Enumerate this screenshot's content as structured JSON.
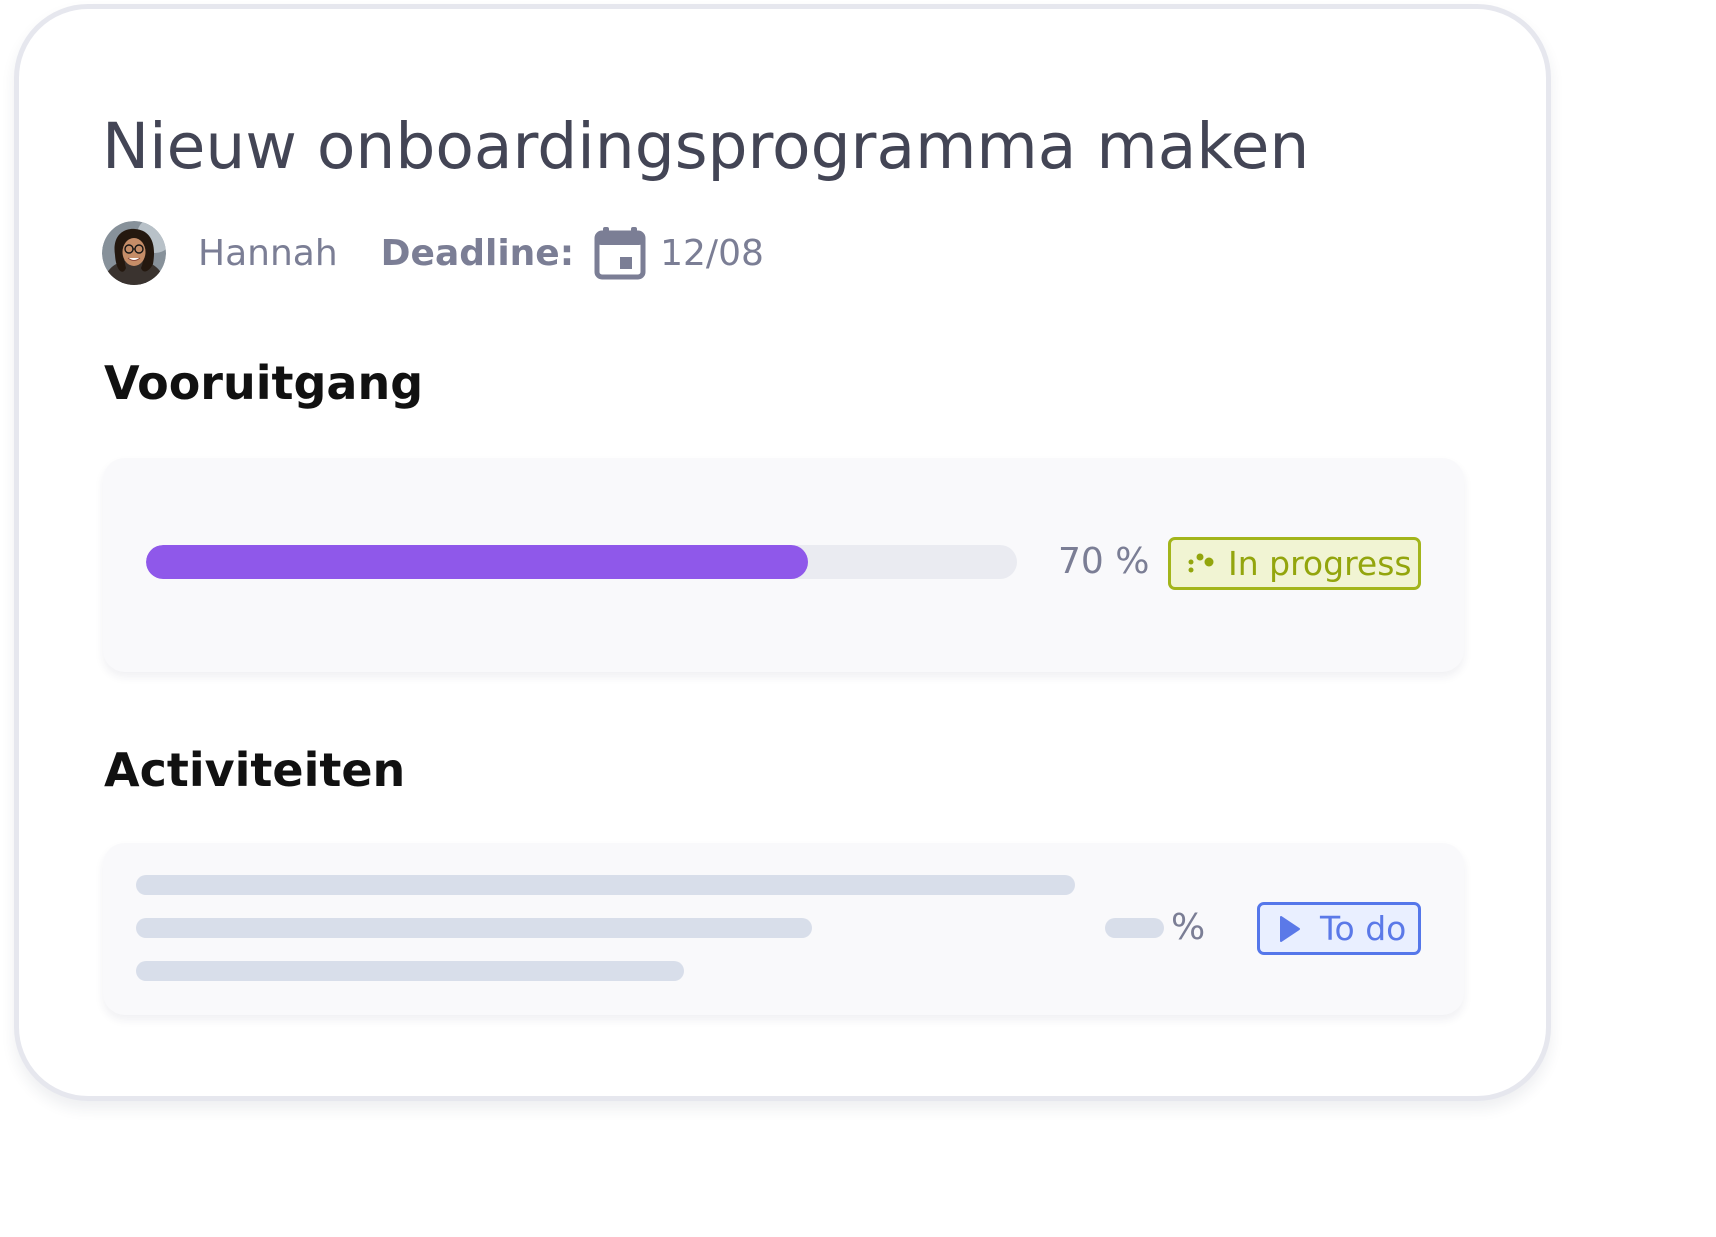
{
  "task": {
    "title": "Nieuw onboardingsprogramma maken",
    "owner": "Hannah",
    "deadline_label": "Deadline:",
    "deadline_date": "12/08"
  },
  "progress": {
    "heading": "Vooruitgang",
    "value_percent": 76,
    "percent_label": "70 %",
    "status_label": "In progress",
    "status_icon": "progress-dots-icon"
  },
  "activities": {
    "heading": "Activiteiten",
    "percent_symbol": "%",
    "status_label": "To do",
    "status_icon": "play-icon"
  },
  "colors": {
    "accent": "#8f58ea",
    "in_progress": "#a3b51b",
    "to_do": "#5577ea"
  }
}
